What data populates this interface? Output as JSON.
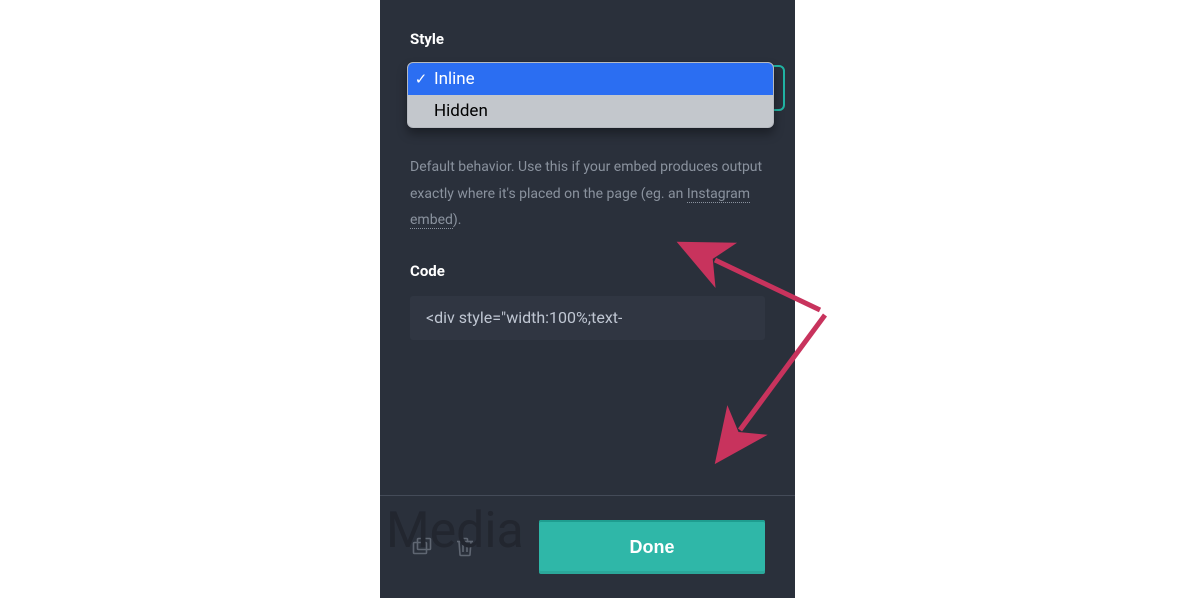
{
  "style": {
    "label": "Style",
    "options": [
      "Inline",
      "Hidden"
    ],
    "selected_index": 0,
    "help_pre": "Default behavior. Use this if your embed produces output exactly where it's placed on the page (eg. an ",
    "help_link": "Instagram embed",
    "help_post": ")."
  },
  "code": {
    "label": "Code",
    "value": "<div style=\"width:100%;text-"
  },
  "footer": {
    "bg_text": "Media",
    "done_label": "Done"
  },
  "colors": {
    "panel_bg": "#2a303b",
    "accent": "#2fb7a8",
    "select_hl": "#2b6ef2",
    "arrow": "#c8335d"
  }
}
